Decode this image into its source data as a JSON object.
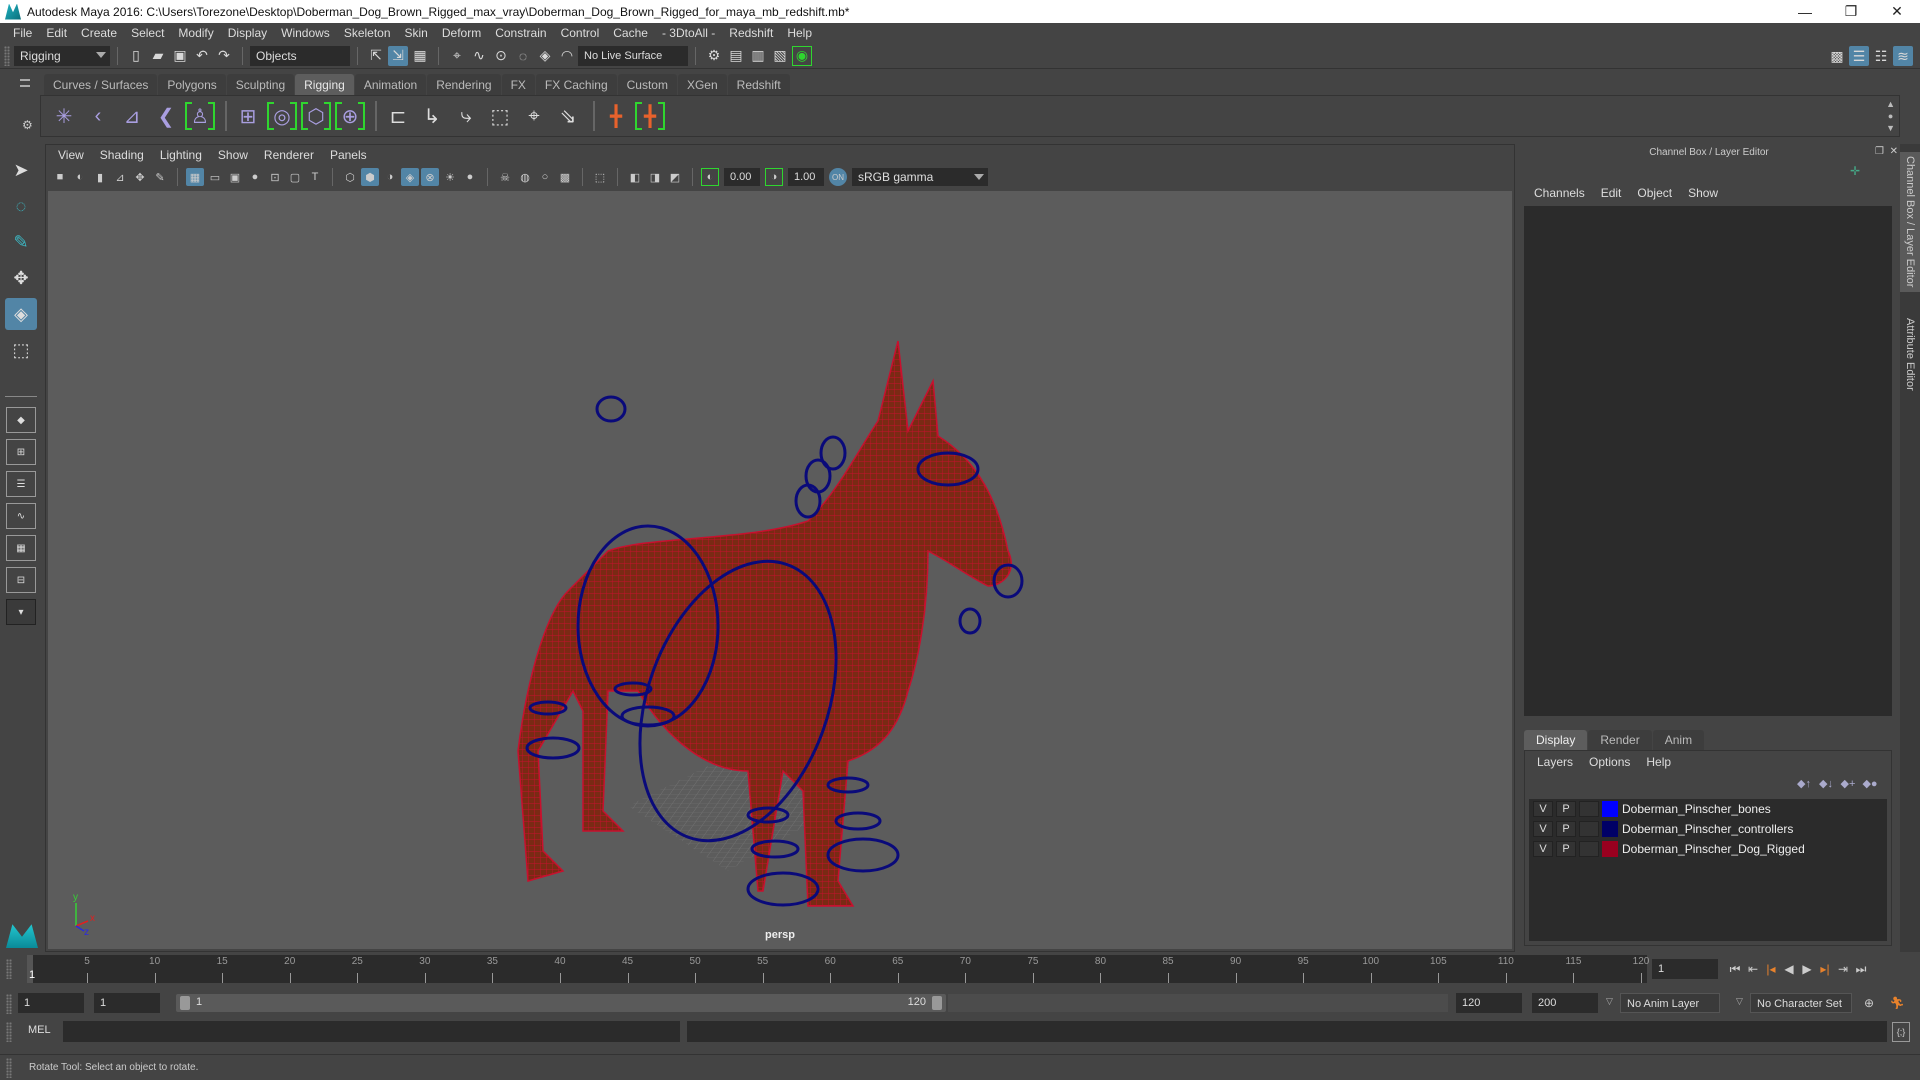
{
  "window": {
    "title": "Autodesk Maya 2016: C:\\Users\\Torezone\\Desktop\\Doberman_Dog_Brown_Rigged_max_vray\\Doberman_Dog_Brown_Rigged_for_maya_mb_redshift.mb*",
    "minimize": "—",
    "restore": "❐",
    "close": "✕"
  },
  "menubar": [
    "File",
    "Edit",
    "Create",
    "Select",
    "Modify",
    "Display",
    "Windows",
    "Skeleton",
    "Skin",
    "Deform",
    "Constrain",
    "Control",
    "Cache",
    "- 3DtoAll -",
    "Redshift",
    "Help"
  ],
  "statusline": {
    "menuset": "Rigging",
    "selection_mode": "Objects",
    "live_surface": "No Live Surface"
  },
  "shelf": {
    "tabs": [
      "Curves / Surfaces",
      "Polygons",
      "Sculpting",
      "Rigging",
      "Animation",
      "Rendering",
      "FX",
      "FX Caching",
      "Custom",
      "XGen",
      "Redshift"
    ],
    "active_tab": "Rigging",
    "icons": [
      "joint-tool-icon",
      "insert-joint-icon",
      "mirror-joint-icon",
      "ik-handle-icon",
      "quick-rig-icon",
      "paint-weights-icon",
      "smooth-bind-icon",
      "lattice-icon",
      "cluster-icon",
      "parent-constraint-icon",
      "point-constraint-icon",
      "orient-constraint-icon",
      "scale-constraint-icon",
      "aim-constraint-icon",
      "pole-vector-icon",
      "hik-icon",
      "hik-char-icon"
    ]
  },
  "viewport": {
    "menu": [
      "View",
      "Shading",
      "Lighting",
      "Show",
      "Renderer",
      "Panels"
    ],
    "exposure": "0.00",
    "gamma": "1.00",
    "color_space": "sRGB gamma",
    "camera": "persp",
    "axis": {
      "x": "x",
      "y": "y",
      "z": "z"
    }
  },
  "channel_box": {
    "title": "Channel Box / Layer Editor",
    "menu": [
      "Channels",
      "Edit",
      "Object",
      "Show"
    ]
  },
  "layer_editor": {
    "tabs": [
      "Display",
      "Render",
      "Anim"
    ],
    "active_tab": "Display",
    "menu": [
      "Layers",
      "Options",
      "Help"
    ],
    "layers": [
      {
        "v": "V",
        "p": "P",
        "name": "Doberman_Pinscher_bones",
        "color": "#0000ff"
      },
      {
        "v": "V",
        "p": "P",
        "name": "Doberman_Pinscher_controllers",
        "color": "#000066"
      },
      {
        "v": "V",
        "p": "P",
        "name": "Doberman_Pinscher_Dog_Rigged",
        "color": "#99001f"
      }
    ]
  },
  "side_tabs": [
    "Channel Box / Layer Editor",
    "Attribute Editor"
  ],
  "timeline": {
    "ticks": [
      "5",
      "10",
      "15",
      "20",
      "25",
      "30",
      "35",
      "40",
      "45",
      "50",
      "55",
      "60",
      "65",
      "70",
      "75",
      "80",
      "85",
      "90",
      "95",
      "100",
      "105",
      "110",
      "115",
      "120"
    ],
    "current_frame_label": "1",
    "current_frame": "1",
    "range_start_min": 1,
    "range_end_max": 120
  },
  "range": {
    "start": "1",
    "playback_start": "1",
    "slider_start": "1",
    "slider_end": "120",
    "playback_end": "120",
    "end": "200",
    "anim_layer": "No Anim Layer",
    "character_set": "No Character Set"
  },
  "command_line": {
    "language": "MEL"
  },
  "help_line": "Rotate Tool: Select an object to rotate.",
  "colors": {
    "accent": "#5285a6",
    "wireframe": "#c8102e",
    "controllers": "#0a0a7a",
    "highlight_bracket": "#2fd62f"
  }
}
